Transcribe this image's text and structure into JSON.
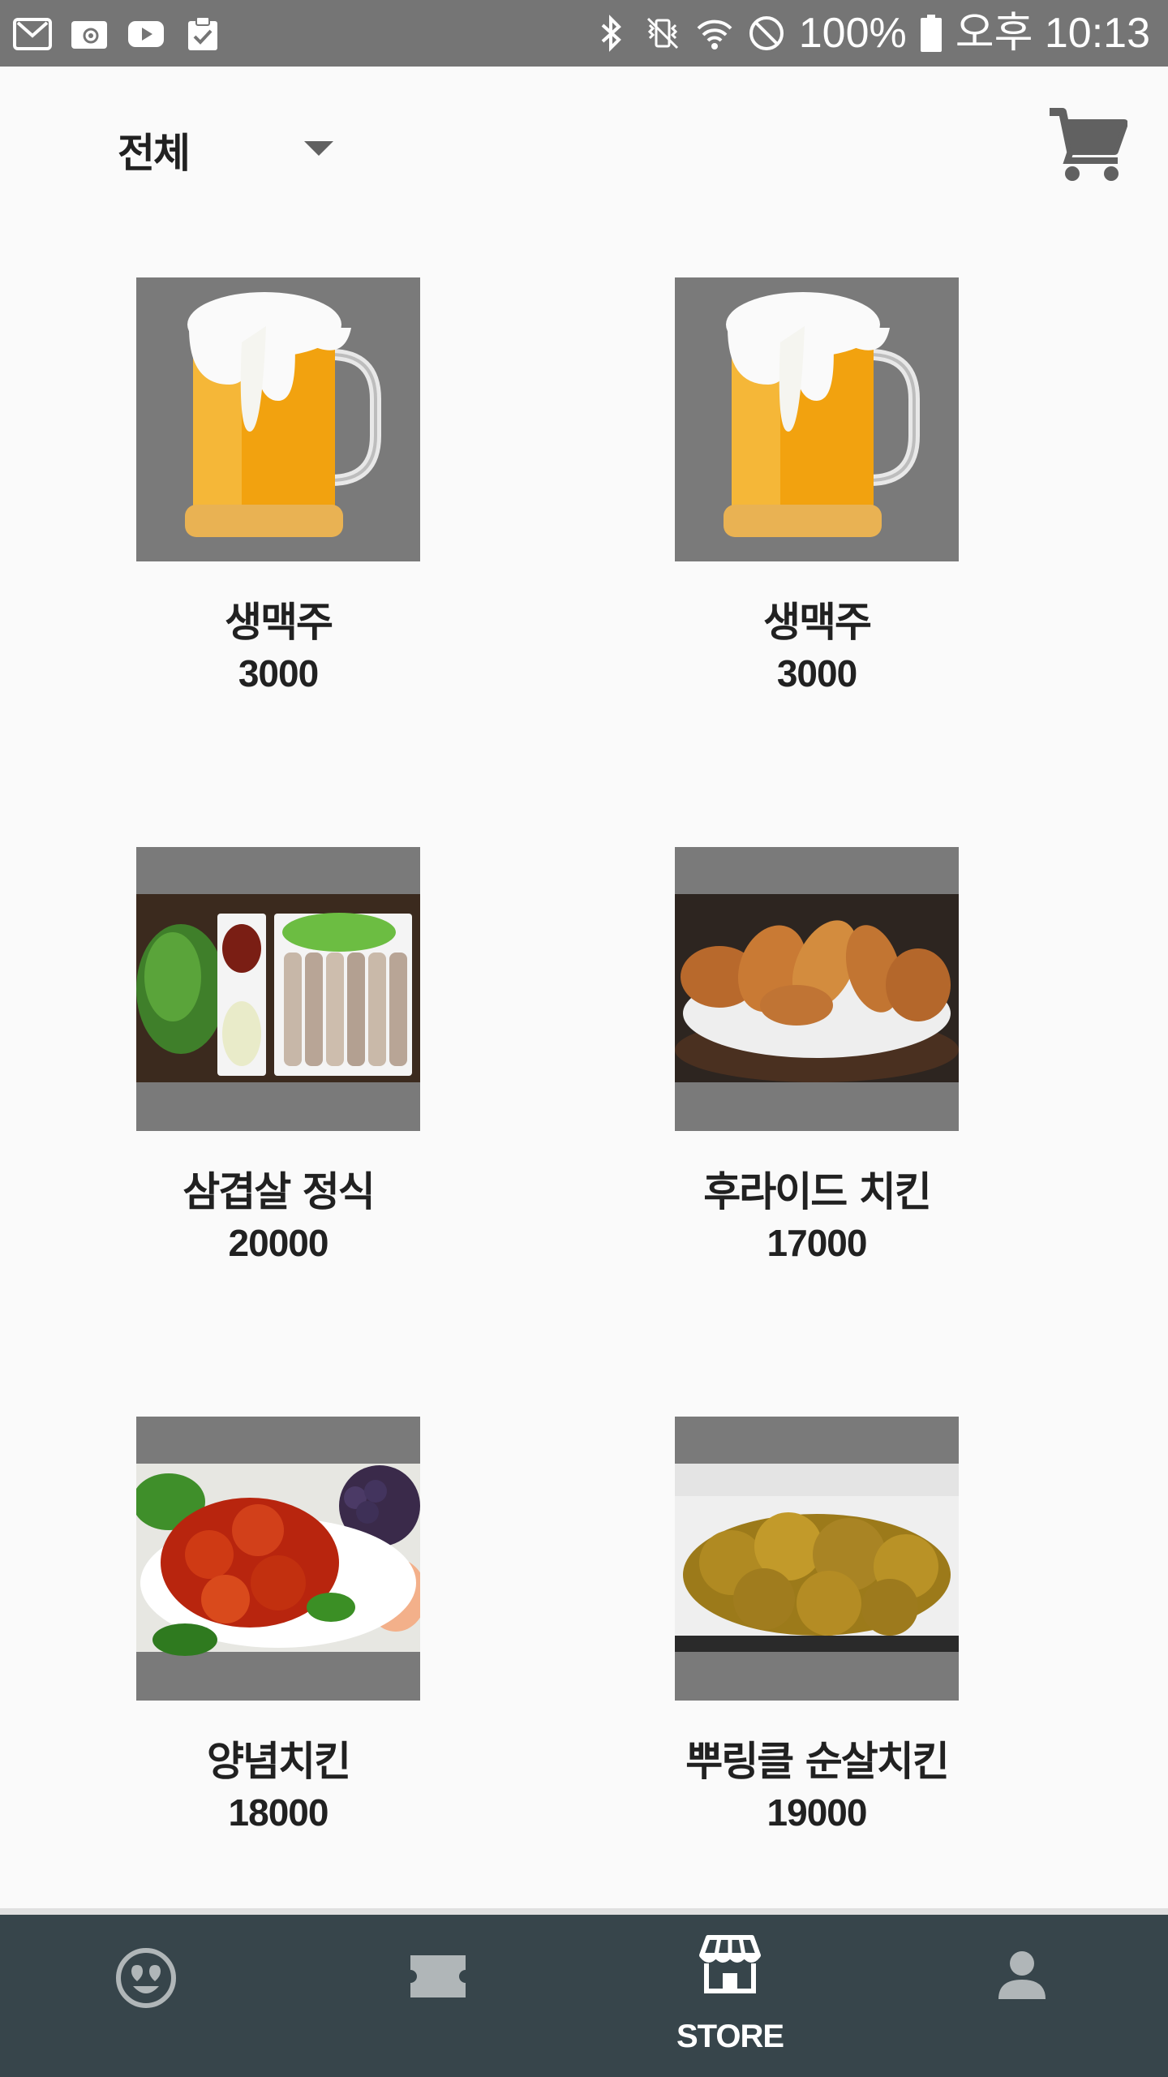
{
  "status_bar": {
    "left_icons": [
      "gmail-icon",
      "email-icon",
      "youtube-icon",
      "clipboard-check-icon"
    ],
    "right_icons": [
      "bluetooth-icon",
      "vibrate-icon",
      "wifi-icon",
      "do-not-disturb-icon"
    ],
    "battery_percent_label": "100%",
    "battery_level": 1.0,
    "time": "오후 10:13"
  },
  "header": {
    "filter_label": "전체",
    "filter_icon": "dropdown-arrow-icon",
    "cart_icon": "shopping-cart-icon"
  },
  "products": [
    {
      "name": "생맥주",
      "price": "3000",
      "image": "beer-mug-photo"
    },
    {
      "name": "생맥주",
      "price": "3000",
      "image": "beer-mug-photo"
    },
    {
      "name": "삼겹살 정식",
      "price": "20000",
      "image": "pork-belly-set-photo"
    },
    {
      "name": "후라이드 치킨",
      "price": "17000",
      "image": "fried-chicken-photo"
    },
    {
      "name": "양념치킨",
      "price": "18000",
      "image": "seasoned-chicken-photo"
    },
    {
      "name": "뿌링클 순살치킨",
      "price": "19000",
      "image": "boneless-chicken-photo"
    }
  ],
  "bottom_nav": {
    "items": [
      {
        "icon": "smiley-heart-eyes-icon",
        "label": ""
      },
      {
        "icon": "ticket-icon",
        "label": ""
      },
      {
        "icon": "store-icon",
        "label": "STORE",
        "active": true
      },
      {
        "icon": "person-icon",
        "label": ""
      }
    ],
    "background": "#37454b"
  },
  "colors": {
    "status_bar": "#757575",
    "background": "#fafafa",
    "text": "#212121",
    "thumb_placeholder": "#7a7a7a"
  }
}
